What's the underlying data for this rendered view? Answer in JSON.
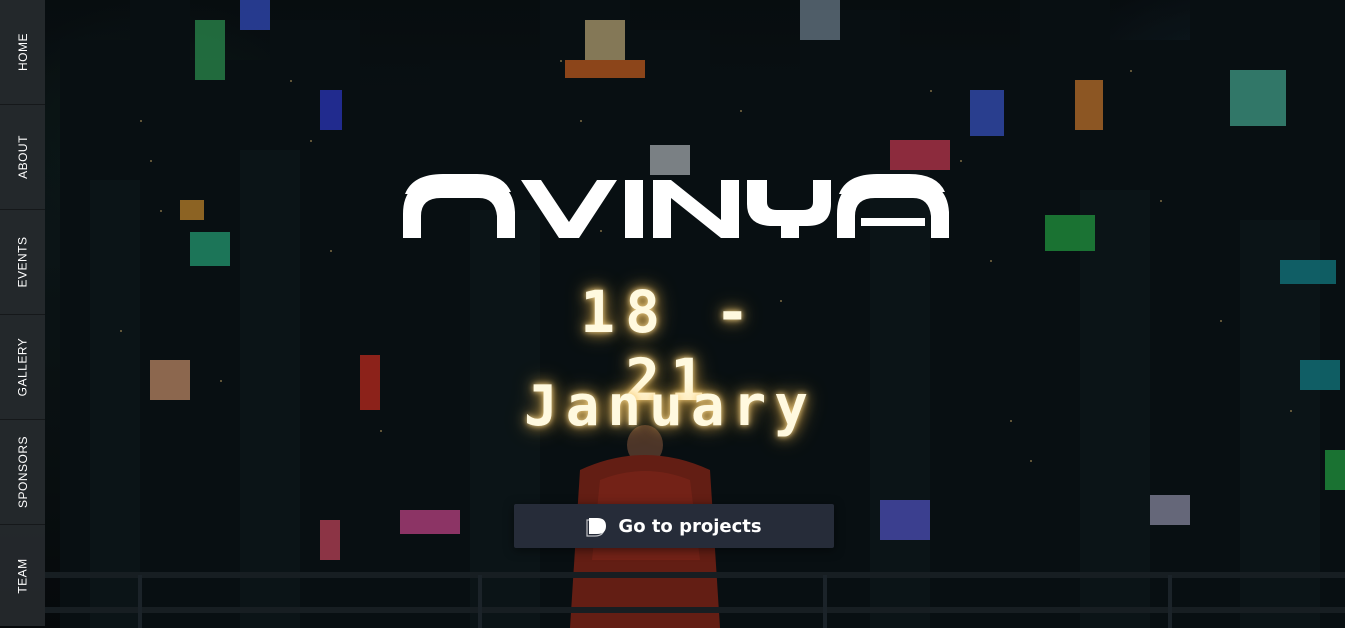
{
  "nav": {
    "items": [
      {
        "label": "HOME"
      },
      {
        "label": "ABOUT"
      },
      {
        "label": "EVENTS"
      },
      {
        "label": "GALLERY"
      },
      {
        "label": "SPONSORS"
      },
      {
        "label": "TEAM"
      }
    ]
  },
  "hero": {
    "logo_text": "AVINYA",
    "dates": "18 - 21",
    "month": "January",
    "cta": {
      "label": "Go to projects",
      "icon": "devfolio-logo-icon"
    }
  },
  "colors": {
    "nav_bg": "#262a2e",
    "cta_bg": "#262c39",
    "glow": "#f4d38a",
    "text": "#ffffff"
  }
}
